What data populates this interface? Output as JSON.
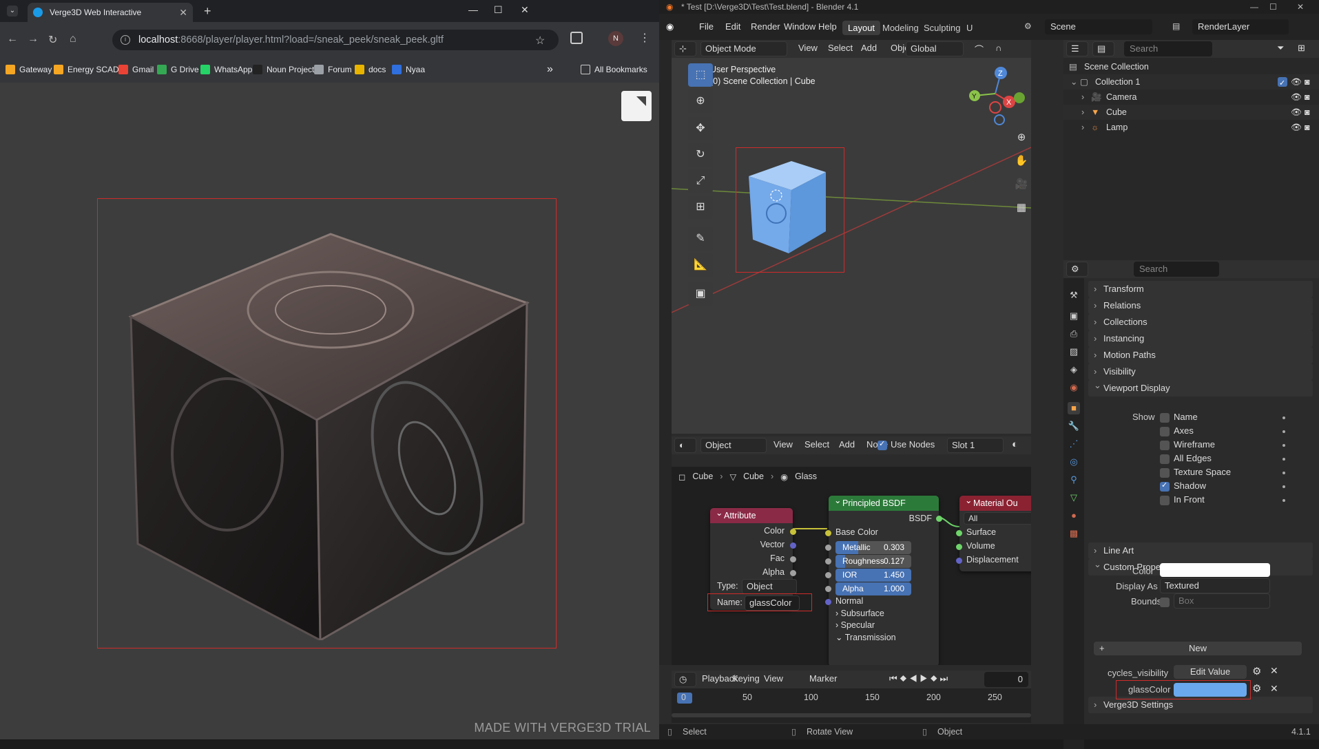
{
  "browser": {
    "tab_title": "Verge3D Web Interactive",
    "url_host": "localhost",
    "url_path": ":8668/player/player.html?load=/sneak_peek/sneak_peek.gltf",
    "profile_initial": "N",
    "bookmarks": [
      "Gateway",
      "Energy SCADA",
      "Gmail",
      "G Drive",
      "WhatsApp",
      "Noun Project",
      "Forum",
      "docs",
      "Nyaa"
    ],
    "bookmark_colors": [
      "#f5a623",
      "#f5a623",
      "#ea4335",
      "#34a853",
      "#25d366",
      "#222222",
      "#9aa0a6",
      "#e8b400",
      "#2f6fde"
    ],
    "more_bookmarks": "»",
    "all_bookmarks": "All Bookmarks"
  },
  "viewer": {
    "watermark": "MADE WITH VERGE3D TRIAL"
  },
  "blender": {
    "window_title": "* Test [D:\\Verge3D\\Test\\Test.blend] - Blender 4.1",
    "menu": [
      "File",
      "Edit",
      "Render",
      "Window",
      "Help"
    ],
    "workspaces": [
      "Layout",
      "Modeling",
      "Sculpting",
      "U"
    ],
    "scene": "Scene",
    "render_layer": "RenderLayer",
    "viewport": {
      "mode": "Object Mode",
      "menus": [
        "View",
        "Select",
        "Add",
        "Object"
      ],
      "orientation": "Global",
      "perspective_label": "User Perspective",
      "collection_label": "(0) Scene Collection | Cube",
      "gizmo_axes": [
        "Z",
        "X",
        "Y"
      ]
    },
    "outliner": {
      "search_placeholder": "Search",
      "rows": [
        "Scene Collection",
        "Collection 1",
        "Camera",
        "Cube",
        "Lamp"
      ]
    },
    "properties": {
      "search_placeholder": "Search",
      "sections": [
        "Transform",
        "Relations",
        "Collections",
        "Instancing",
        "Motion Paths",
        "Visibility",
        "Viewport Display",
        "Line Art",
        "Custom Properties",
        "Verge3D Settings"
      ],
      "show_label": "Show",
      "show_options": [
        {
          "label": "Name",
          "checked": false
        },
        {
          "label": "Axes",
          "checked": false
        },
        {
          "label": "Wireframe",
          "checked": false
        },
        {
          "label": "All Edges",
          "checked": false
        },
        {
          "label": "Texture Space",
          "checked": false
        },
        {
          "label": "Shadow",
          "checked": true
        },
        {
          "label": "In Front",
          "checked": false
        }
      ],
      "color_label": "Color",
      "color_value": "#ffffff",
      "display_as_label": "Display As",
      "display_as_value": "Textured",
      "bounds_label": "Bounds",
      "bounds_value": "Box",
      "new_button": "New",
      "custom_props": [
        {
          "name": "cycles_visibility",
          "value": "Edit Value"
        },
        {
          "name": "glassColor",
          "color": "#6aa9ee"
        }
      ]
    },
    "node_editor": {
      "object_dropdown": "Object",
      "menus": [
        "View",
        "Select",
        "Add",
        "Node"
      ],
      "use_nodes_label": "Use Nodes",
      "slot": "Slot 1",
      "breadcrumb": [
        "Cube",
        "Cube",
        "Glass"
      ],
      "attribute_node": {
        "title": "Attribute",
        "outputs": [
          "Color",
          "Vector",
          "Fac",
          "Alpha"
        ],
        "type_label": "Type:",
        "type_value": "Object",
        "name_label": "Name:",
        "name_value": "glassColor"
      },
      "bsdf_node": {
        "title": "Principled BSDF",
        "output": "BSDF",
        "base_color": "Base Color",
        "sliders": [
          {
            "label": "Metallic",
            "value": "0.303",
            "fill": 0.303,
            "blue": false
          },
          {
            "label": "Roughness",
            "value": "0.127",
            "fill": 0.127,
            "blue": false
          },
          {
            "label": "IOR",
            "value": "1.450",
            "fill": 1.0,
            "blue": true
          },
          {
            "label": "Alpha",
            "value": "1.000",
            "fill": 1.0,
            "blue": true
          }
        ],
        "normal": "Normal",
        "panels": [
          "Subsurface",
          "Specular",
          "Transmission"
        ]
      },
      "output_node": {
        "title": "Material Ou",
        "target": "All",
        "inputs": [
          "Surface",
          "Volume",
          "Displacement"
        ]
      }
    },
    "timeline": {
      "menus": [
        "Playback",
        "Keying",
        "View",
        "Marker"
      ],
      "current_frame": "0",
      "ticks": [
        "0",
        "50",
        "100",
        "150",
        "200",
        "250"
      ]
    },
    "status": {
      "items": [
        "Select",
        "Rotate View",
        "Object"
      ],
      "version": "4.1.1"
    }
  }
}
